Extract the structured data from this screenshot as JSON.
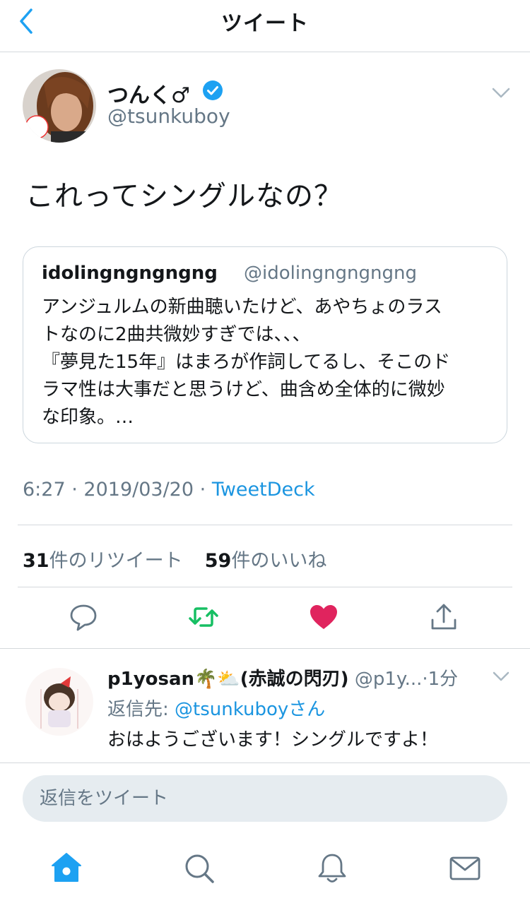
{
  "nav": {
    "title": "ツイート",
    "back_icon": "chevron-left-icon"
  },
  "tweet": {
    "author_name": "つんく♂",
    "author_handle": "@tsunkuboy",
    "verified_icon": "verified-badge-icon",
    "text": "これってシングルなの？",
    "quote": {
      "name": "idolingngngngng",
      "handle": "@idolingngngngng",
      "lines": [
        "アンジュルムの新曲聴いたけど、あやちょのラス",
        "トなのに2曲共微妙すぎでは、、、",
        "『夢見た15年』はまろが作詞してるし、そこのド",
        "ラマ性は大事だと思うけど、曲含め全体的に微妙",
        "な印象。…"
      ]
    },
    "time": "6:27",
    "date": "2019/03/20",
    "separator": "·",
    "source": "TweetDeck",
    "retweets_count": "31",
    "retweets_label": "件のリツイート",
    "likes_count": "59",
    "likes_label": "件のいいね"
  },
  "actions": [
    "reply-icon",
    "retweet-icon",
    "like-icon",
    "share-icon"
  ],
  "reply": {
    "name": "p1yosan",
    "emojis": "🌴⛅",
    "name_suffix": "(赤誠の閃刃)",
    "handle": "@p1y...",
    "time": "1分",
    "reply_to_prefix": "返信先:",
    "reply_to_handle": "@tsunkuboyさん",
    "text": "おはようございます！シングルですよ！"
  },
  "compose": {
    "placeholder": "返信をツイート"
  },
  "tabs": [
    "home-icon",
    "search-icon",
    "notifications-icon",
    "messages-icon"
  ],
  "colors": {
    "accent": "#1da1f2",
    "link": "#1b95e0",
    "retweet": "#17bf63",
    "like": "#e0245e",
    "secondary_text": "#657786"
  }
}
